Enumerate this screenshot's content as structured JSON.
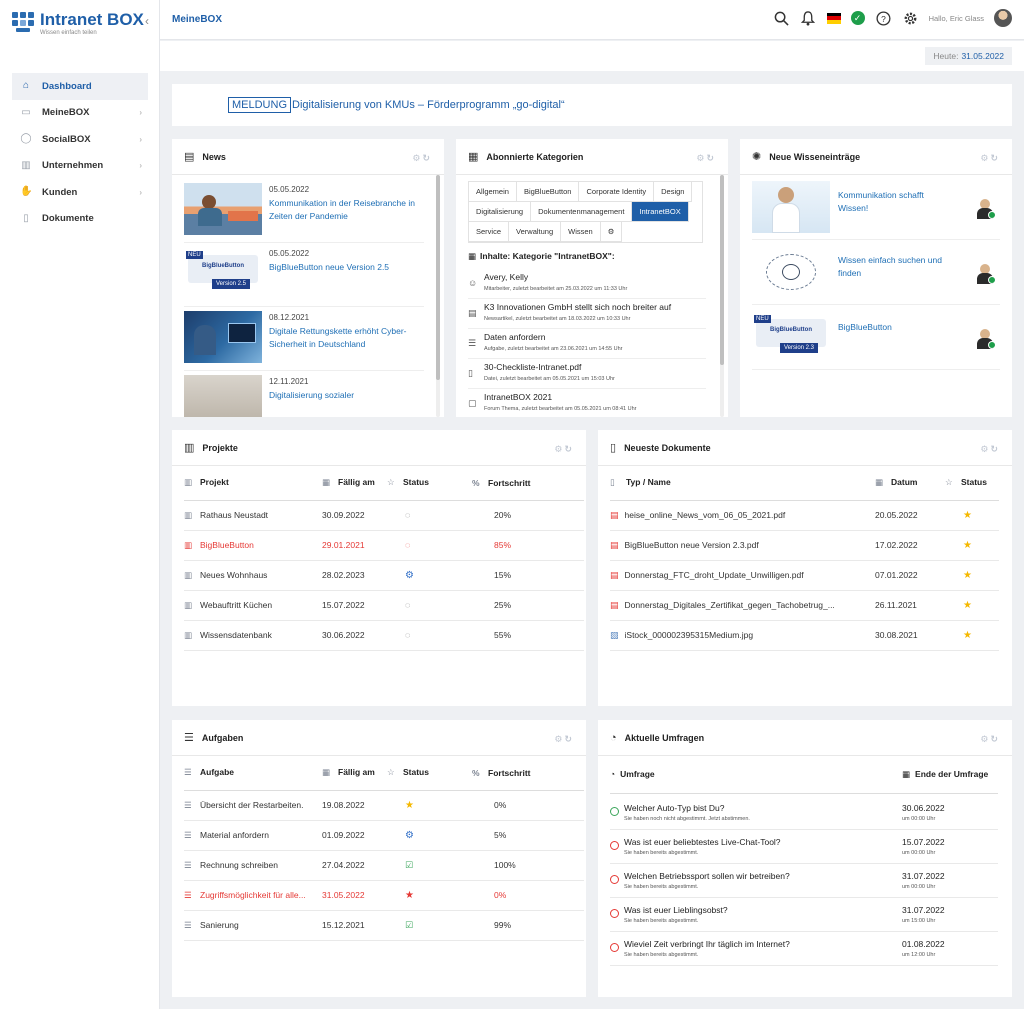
{
  "app": {
    "logo_title": "Intranet BOX",
    "logo_subtitle": "Wissen einfach teilen"
  },
  "sidebar": {
    "items": [
      {
        "label": "Dashboard",
        "icon": "home-icon",
        "active": true
      },
      {
        "label": "MeineBOX",
        "icon": "box-icon"
      },
      {
        "label": "SocialBOX",
        "icon": "chat-icon"
      },
      {
        "label": "Unternehmen",
        "icon": "building-icon"
      },
      {
        "label": "Kunden",
        "icon": "handshake-icon"
      },
      {
        "label": "Dokumente",
        "icon": "document-icon"
      }
    ]
  },
  "header": {
    "page_title": "MeineBOX",
    "greeting": "Hallo, Eric Glass",
    "today_label": "Heute:",
    "today_value": "31.05.2022"
  },
  "banner": {
    "tag": "MELDUNG",
    "text": "Digitalisierung von KMUs – Förderprogramm „go-digital“"
  },
  "news": {
    "title": "News",
    "items": [
      {
        "date": "05.05.2022",
        "title": "Kommunikation in der Reisebranche in Zeiten der Pandemie"
      },
      {
        "date": "05.05.2022",
        "title": "BigBlueButton neue Version 2.5"
      },
      {
        "date": "08.12.2021",
        "title": "Digitale Rettungskette erhöht Cyber-Sicherheit in Deutschland"
      },
      {
        "date": "12.11.2021",
        "title": "Digitalisierung sozialer"
      }
    ],
    "thumb_badge": "NEU",
    "thumb_product": "BigBlueButton",
    "thumb_version": "Version 2.5"
  },
  "categories": {
    "title": "Abonnierte Kategorien",
    "tabs": [
      "Allgemein",
      "BigBlueButton",
      "Corporate Identity",
      "Design",
      "Digitalisierung",
      "Dokumentenmanagement",
      "IntranetBOX",
      "Service",
      "Verwaltung",
      "Wissen"
    ],
    "active_tab": "IntranetBOX",
    "heading": "Inhalte: Kategorie \"IntranetBOX\":",
    "items": [
      {
        "title": "Avery, Kelly",
        "sub": "Mitarbeiter, zuletzt bearbeitet am 25.03.2022 um 11:33 Uhr",
        "icon": "user-icon"
      },
      {
        "title": "K3 Innovationen GmbH stellt sich noch breiter auf",
        "sub": "Newsartikel, zuletzt bearbeitet am 18.03.2022 um 10:33 Uhr",
        "icon": "news-icon"
      },
      {
        "title": "Daten anfordern",
        "sub": "Aufgabe, zuletzt bearbeitet am 23.06.2021 um 14:55 Uhr",
        "icon": "tasks-icon"
      },
      {
        "title": "30-Checkliste-Intranet.pdf",
        "sub": "Datei, zuletzt bearbeitet am 05.05.2021 um 15:03 Uhr",
        "icon": "file-icon"
      },
      {
        "title": "IntranetBOX 2021",
        "sub": "Forum Thema, zuletzt bearbeitet am 05.05.2021 um 08:41 Uhr",
        "icon": "forum-icon"
      }
    ]
  },
  "knowledge": {
    "title": "Neue Wisseneinträge",
    "items": [
      {
        "title": "Kommunikation schafft Wissen!"
      },
      {
        "title": "Wissen einfach suchen und finden"
      },
      {
        "title": "BigBlueButton"
      }
    ],
    "thumb_badge": "NEU",
    "thumb_product": "BigBlueButton",
    "thumb_version": "Version 2.3"
  },
  "projects": {
    "title": "Projekte",
    "columns": [
      "Projekt",
      "Fällig am",
      "Status",
      "Fortschritt"
    ],
    "rows": [
      {
        "name": "Rathaus Neustadt",
        "due": "30.09.2022",
        "status": "chat",
        "progress": "20%",
        "overdue": false
      },
      {
        "name": "BigBlueButton",
        "due": "29.01.2021",
        "status": "chat",
        "progress": "85%",
        "overdue": true
      },
      {
        "name": "Neues Wohnhaus",
        "due": "28.02.2023",
        "status": "gear",
        "progress": "15%",
        "overdue": false
      },
      {
        "name": "Webauftritt Küchen",
        "due": "15.07.2022",
        "status": "chat",
        "progress": "25%",
        "overdue": false
      },
      {
        "name": "Wissensdatenbank",
        "due": "30.06.2022",
        "status": "chat",
        "progress": "55%",
        "overdue": false
      }
    ]
  },
  "documents": {
    "title": "Neueste Dokumente",
    "columns": [
      "Typ / Name",
      "Datum",
      "Status"
    ],
    "rows": [
      {
        "name": "heise_online_News_vom_06_05_2021.pdf",
        "date": "20.05.2022",
        "type": "pdf"
      },
      {
        "name": "BigBlueButton neue Version 2.3.pdf",
        "date": "17.02.2022",
        "type": "pdf"
      },
      {
        "name": "Donnerstag_FTC_droht_Update_Unwilligen.pdf",
        "date": "07.01.2022",
        "type": "pdf"
      },
      {
        "name": "Donnerstag_Digitales_Zertifikat_gegen_Tachobetrug_...",
        "date": "26.11.2021",
        "type": "pdf"
      },
      {
        "name": "iStock_000002395315Medium.jpg",
        "date": "30.08.2021",
        "type": "image"
      }
    ]
  },
  "tasks": {
    "title": "Aufgaben",
    "columns": [
      "Aufgabe",
      "Fällig am",
      "Status",
      "Fortschritt"
    ],
    "rows": [
      {
        "name": "Übersicht der Restarbeiten.",
        "due": "19.08.2022",
        "status": "star",
        "progress": "0%",
        "overdue": false
      },
      {
        "name": "Material anfordern",
        "due": "01.09.2022",
        "status": "gear",
        "progress": "5%",
        "overdue": false
      },
      {
        "name": "Rechnung schreiben",
        "due": "27.04.2022",
        "status": "check",
        "progress": "100%",
        "overdue": false
      },
      {
        "name": "Zugriffsmöglichkeit für alle...",
        "due": "31.05.2022",
        "status": "star-red",
        "progress": "0%",
        "overdue": true
      },
      {
        "name": "Sanierung",
        "due": "15.12.2021",
        "status": "check",
        "progress": "99%",
        "overdue": false
      }
    ]
  },
  "polls": {
    "title": "Aktuelle Umfragen",
    "columns": [
      "Umfrage",
      "Ende der Umfrage"
    ],
    "rows": [
      {
        "question": "Welcher Auto-Typ bist Du?",
        "sub": "Sie haben noch nicht abgestimmt. Jetzt abstimmen.",
        "date": "30.06.2022",
        "time": "um 00:00 Uhr",
        "voted": false
      },
      {
        "question": "Was ist euer beliebtestes Live-Chat-Tool?",
        "sub": "Sie haben bereits abgestimmt.",
        "date": "15.07.2022",
        "time": "um 00:00 Uhr",
        "voted": true
      },
      {
        "question": "Welchen Betriebssport sollen wir betreiben?",
        "sub": "Sie haben bereits abgestimmt.",
        "date": "31.07.2022",
        "time": "um 00:00 Uhr",
        "voted": true
      },
      {
        "question": "Was ist euer Lieblingsobst?",
        "sub": "Sie haben bereits abgestimmt.",
        "date": "31.07.2022",
        "time": "um 15:00 Uhr",
        "voted": true
      },
      {
        "question": "Wieviel Zeit verbringt Ihr täglich im Internet?",
        "sub": "Sie haben bereits abgestimmt.",
        "date": "01.08.2022",
        "time": "um 12:00 Uhr",
        "voted": true
      }
    ]
  },
  "colors": {
    "brand": "#1f5fa8",
    "link": "#1f6fb5",
    "overdue": "#e53935",
    "star": "#f5b800",
    "ok": "#1e9e4a"
  }
}
